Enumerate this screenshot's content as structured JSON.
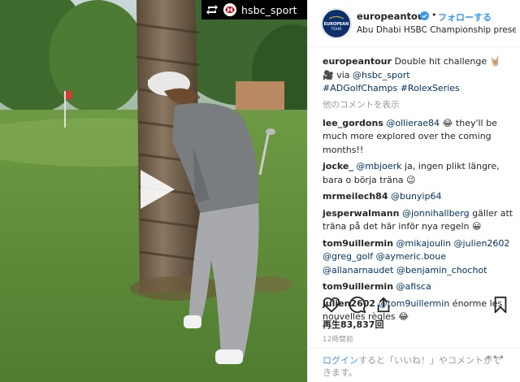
{
  "repost_bar": {
    "icon": "repost-icon",
    "account": "hsbc_sport"
  },
  "video": {
    "play_icon": "play-icon"
  },
  "header": {
    "avatar_text_top": "EUROPEAN",
    "avatar_text_bottom": "TOUR",
    "username": "europeantour",
    "separator": "•",
    "follow_label": "フォローする",
    "location": "Abu Dhabi HSBC Championship presen..."
  },
  "caption": {
    "username": "europeantour",
    "text": "Double hit challenge 🤘🏼",
    "line2_icon": "🎥",
    "line2_text": " via ",
    "line2_mention": "@hsbc_sport",
    "hashtags": "#ADGolfChamps #RolexSeries"
  },
  "view_all_comments": "他のコメントを表示",
  "comments": [
    {
      "user": "lee_gordons",
      "mention": "@ollierae84",
      "text": " 😂 they'll be much more explored over the coming months!!"
    },
    {
      "user": "jocke_",
      "mention": "@mbjoerk",
      "text": " ja, ingen plikt längre, bara o börja träna 😉"
    },
    {
      "user": "mrmeilech84",
      "mention": "@bunyip64",
      "text": ""
    },
    {
      "user": "jesperwalmann",
      "mention": "@jonnihallberg",
      "text": " gäller att träna på det här inför nya regeln 😀"
    },
    {
      "user": "tom9uillermin",
      "mention": "@mikajoulin @julien2602 @greg_golf @aymeric.boue @allanarnaudet @benjamin_chochot",
      "text": ""
    },
    {
      "user": "tom9uillermin",
      "mention": "@afisca",
      "text": ""
    },
    {
      "user": "julien2602",
      "mention": "@tom9uillermin",
      "text": " énorme les nouvelles règles 😂"
    }
  ],
  "actions": {
    "like_icon": "heart-icon",
    "comment_icon": "comment-icon",
    "share_icon": "share-icon",
    "save_icon": "bookmark-icon"
  },
  "views": "再生83,837回",
  "timestamp": "12時間前",
  "footer": {
    "login_link": "ログイン",
    "text": "すると「いいね！」やコメントができます。",
    "more": "•••"
  },
  "colors": {
    "link": "#3897f0",
    "mention": "#003569",
    "muted": "#999999",
    "verified": "#3897f0"
  }
}
